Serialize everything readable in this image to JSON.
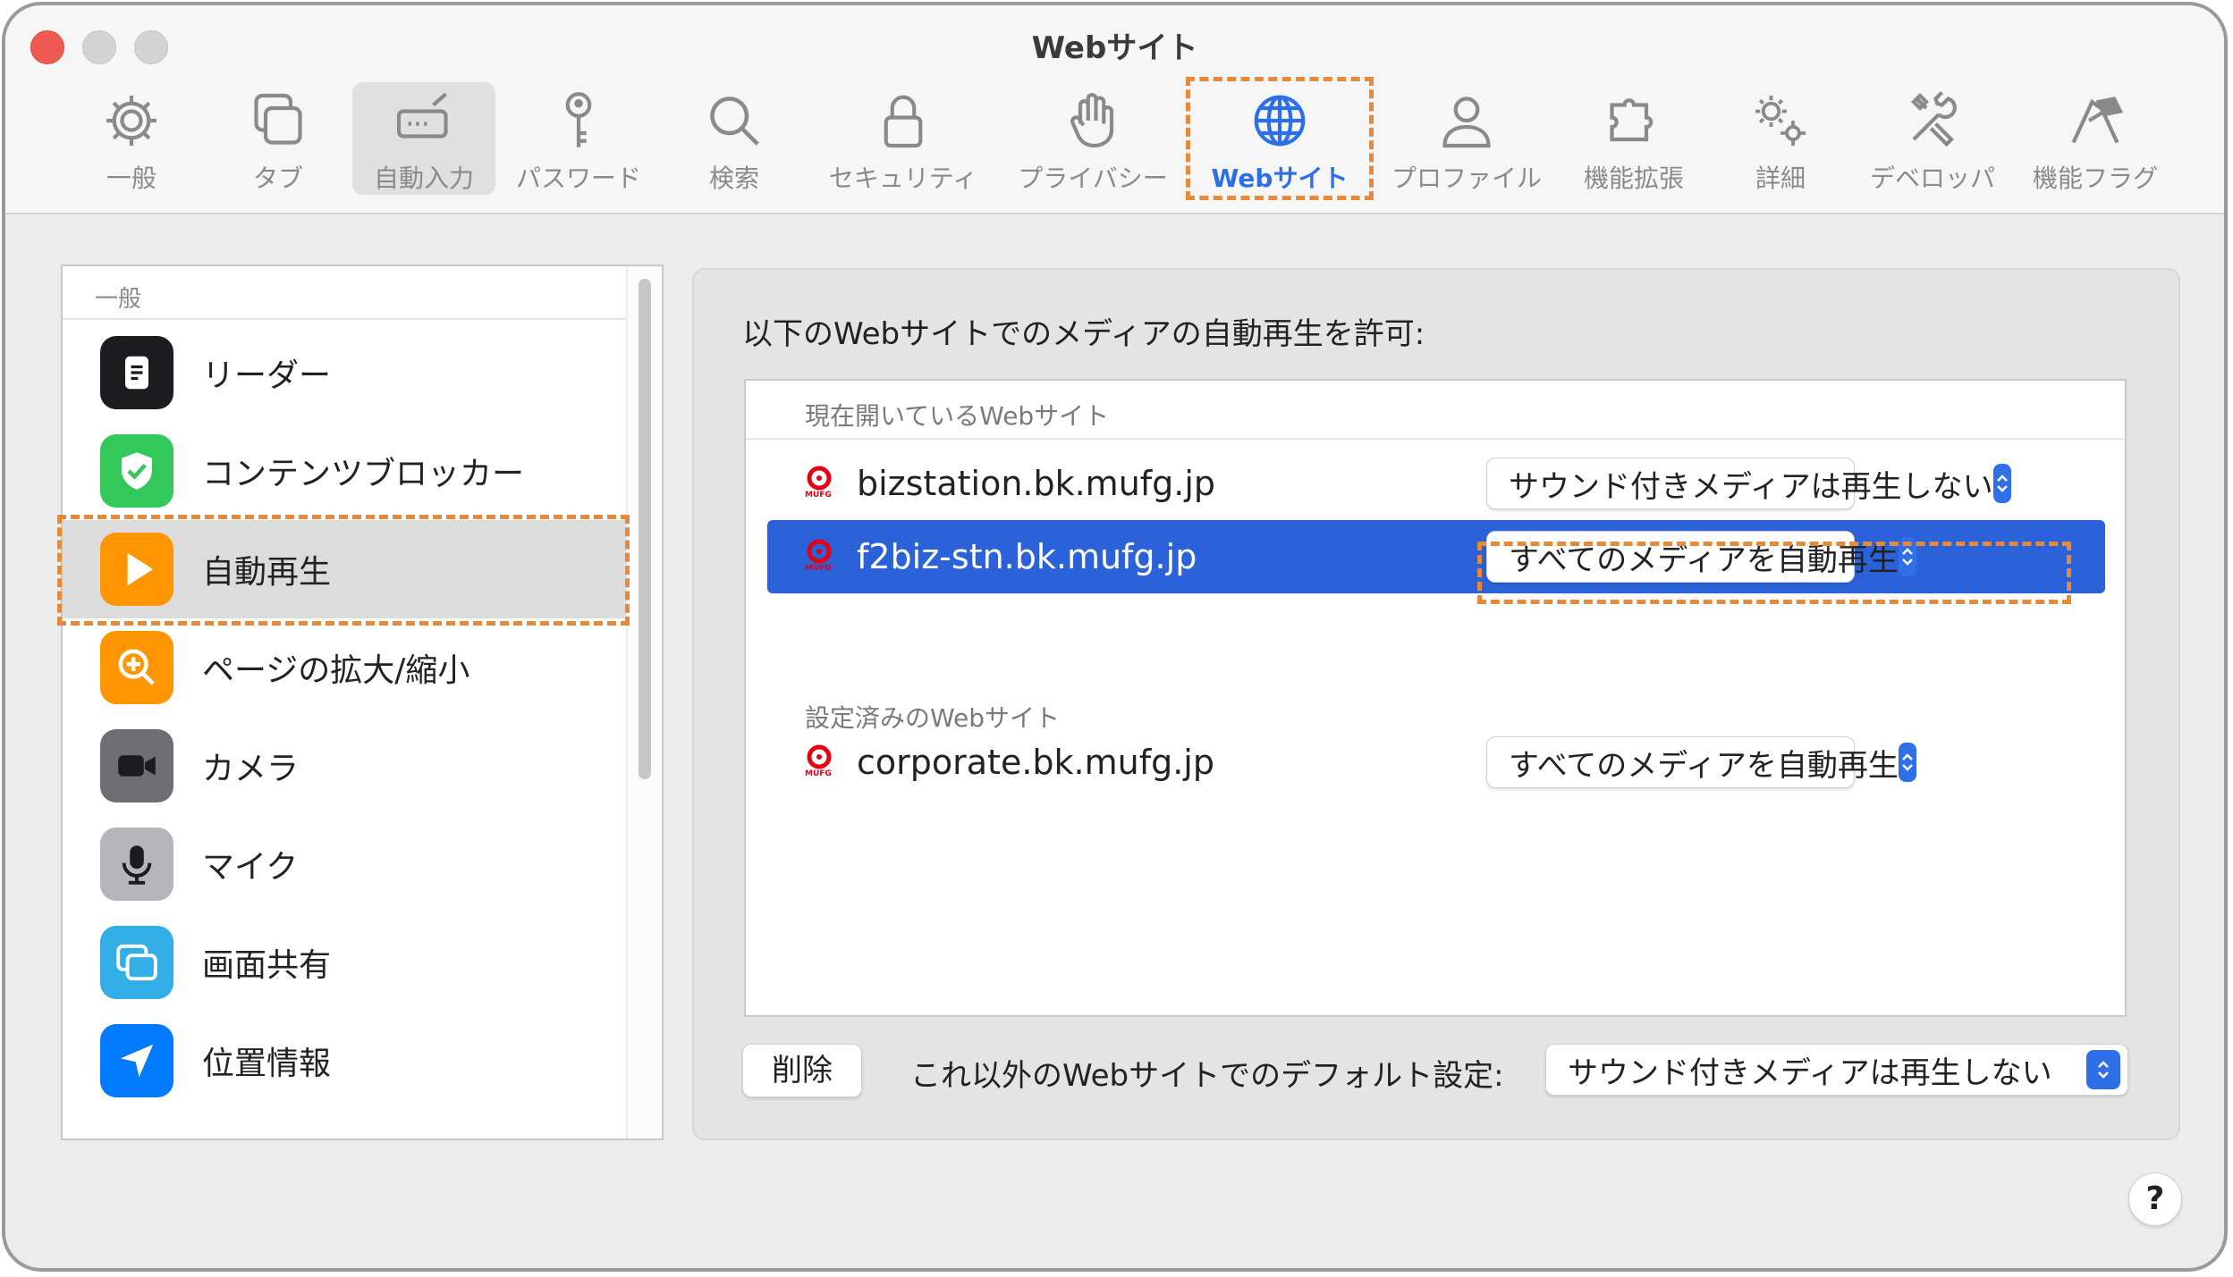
{
  "window": {
    "title": "Webサイト"
  },
  "toolbar": {
    "items": [
      {
        "label": "一般",
        "icon": "gear-icon"
      },
      {
        "label": "タブ",
        "icon": "tabs-icon"
      },
      {
        "label": "自動入力",
        "icon": "autofill-icon"
      },
      {
        "label": "パスワード",
        "icon": "key-icon"
      },
      {
        "label": "検索",
        "icon": "search-icon"
      },
      {
        "label": "セキュリティ",
        "icon": "lock-icon"
      },
      {
        "label": "プライバシー",
        "icon": "hand-icon"
      },
      {
        "label": "Webサイト",
        "icon": "globe-icon"
      },
      {
        "label": "プロファイル",
        "icon": "person-icon"
      },
      {
        "label": "機能拡張",
        "icon": "puzzle-icon"
      },
      {
        "label": "詳細",
        "icon": "gears-icon"
      },
      {
        "label": "デベロッパ",
        "icon": "tools-icon"
      },
      {
        "label": "機能フラグ",
        "icon": "flags-icon"
      }
    ],
    "active_index": 7,
    "pressed_index": 2
  },
  "sidebar": {
    "header": "一般",
    "items": [
      {
        "label": "リーダー",
        "icon": "reader-icon",
        "color": "#1c1c1e"
      },
      {
        "label": "コンテンツブロッカー",
        "icon": "shield-check-icon",
        "color": "#34c759"
      },
      {
        "label": "自動再生",
        "icon": "play-icon",
        "color": "#ff9500"
      },
      {
        "label": "ページの拡大/縮小",
        "icon": "zoom-icon",
        "color": "#ff9500"
      },
      {
        "label": "カメラ",
        "icon": "camera-icon",
        "color": "#6e6e73"
      },
      {
        "label": "マイク",
        "icon": "microphone-icon",
        "color": "#8e8e93"
      },
      {
        "label": "画面共有",
        "icon": "screen-share-icon",
        "color": "#32ade6"
      },
      {
        "label": "位置情報",
        "icon": "location-icon",
        "color": "#007aff"
      }
    ],
    "selected_index": 2
  },
  "main": {
    "title": "以下のWebサイトでのメディアの自動再生を許可:",
    "open_header": "現在開いているWebサイト",
    "configured_header": "設定済みのWebサイト",
    "open_sites": [
      {
        "domain": "bizstation.bk.mufg.jp",
        "setting": "サウンド付きメディアは再生しない"
      },
      {
        "domain": "f2biz-stn.bk.mufg.jp",
        "setting": "すべてのメディアを自動再生"
      }
    ],
    "configured_sites": [
      {
        "domain": "corporate.bk.mufg.jp",
        "setting": "すべてのメディアを自動再生"
      }
    ],
    "logo_text": "MUFG",
    "delete_label": "削除",
    "default_label": "これ以外のWebサイトでのデフォルト設定:",
    "default_value": "サウンド付きメディアは再生しない",
    "help_label": "?"
  },
  "colors": {
    "accent": "#2f6fe8",
    "selection": "#2b62d9",
    "highlight_dash": "#e58a3a",
    "mufg_red": "#e60012"
  }
}
